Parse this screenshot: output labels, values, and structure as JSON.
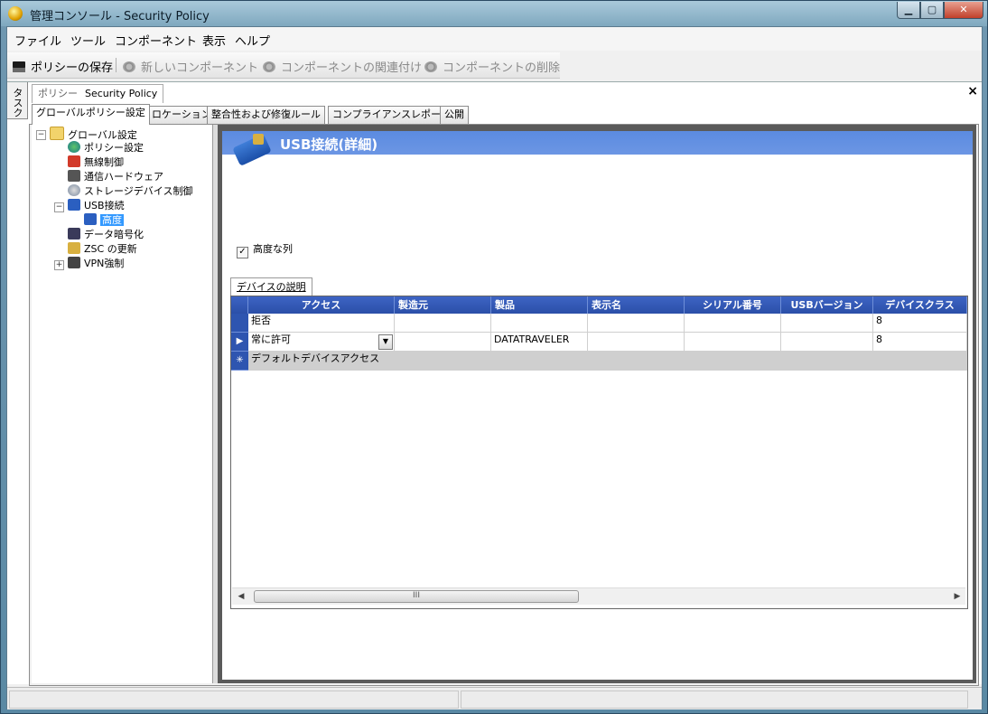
{
  "window": {
    "title": "管理コンソール - Security Policy",
    "min_glyph": "▁",
    "max_glyph": "▢",
    "close_glyph": "✕"
  },
  "menu": [
    "ファイル",
    "ツール",
    "コンポーネント",
    "表示",
    "ヘルプ"
  ],
  "toolbar": {
    "save": "ポリシーの保存",
    "new_component": "新しいコンポーネント",
    "associate_component": "コンポーネントの関連付け",
    "delete_component": "コンポーネントの削除"
  },
  "side_tab": "タスク",
  "doc_tab": {
    "prefix": "ポリシー",
    "name": "Security Policy",
    "close": "×"
  },
  "tabs": [
    "グローバルポリシー設定",
    "ロケーション",
    "整合性および修復ルール",
    "コンプライアンスレポート",
    "公開"
  ],
  "tree": {
    "root": "グローバル設定",
    "items": [
      "ポリシー設定",
      "無線制御",
      "通信ハードウェア",
      "ストレージデバイス制御",
      "USB接続",
      "高度",
      "データ暗号化",
      "ZSC の更新",
      "VPN強制"
    ],
    "expander_minus": "−",
    "expander_plus": "+"
  },
  "content": {
    "title": "USB接続(詳細)",
    "advanced_columns_label": "高度な列",
    "advanced_columns_checked": "✓",
    "grid_tab": "デバイスの説明"
  },
  "grid": {
    "columns": [
      "アクセス",
      "製造元",
      "製品",
      "表示名",
      "シリアル番号",
      "USBバージョン",
      "デバイスクラス"
    ],
    "rows": [
      {
        "marker": "",
        "access": "拒否",
        "manufacturer": "",
        "product": "",
        "display_name": "",
        "serial": "",
        "usb_version": "",
        "device_class": "8"
      },
      {
        "marker": "▶",
        "access": "常に許可",
        "manufacturer": "",
        "product": "DATATRAVELER",
        "display_name": "",
        "serial": "",
        "usb_version": "",
        "device_class": "8"
      }
    ],
    "new_row": {
      "marker": "✳",
      "access": "デフォルトデバイスアクセス"
    },
    "combo_arrow": "▼",
    "scroll_left": "◀",
    "scroll_right": "▶",
    "scroll_thumb": "III"
  },
  "colors": {
    "header_blue": "#5b8be0",
    "grid_header": "#2b4fa8",
    "selection": "#3399ff"
  }
}
